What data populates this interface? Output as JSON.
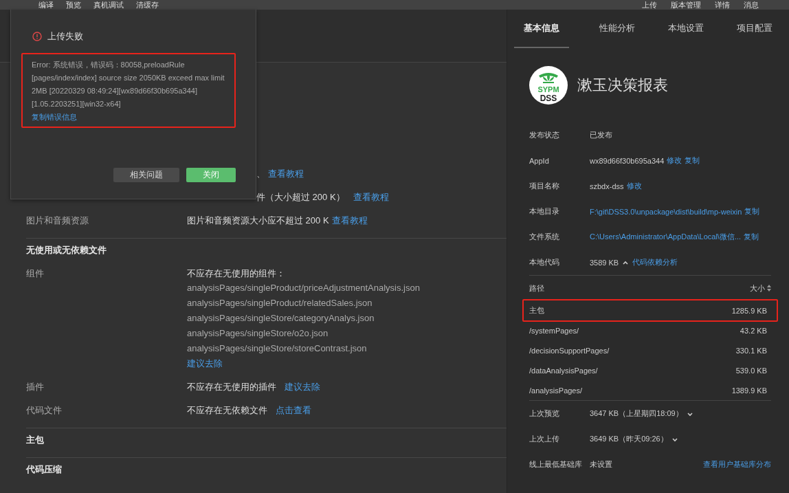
{
  "toolbar": {
    "left_items": [
      "编译",
      "预览",
      "真机调试",
      "清缓存"
    ],
    "right_items": [
      "上传",
      "版本管理",
      "详情",
      "消息"
    ]
  },
  "analysis": {
    "sections": [
      {
        "rows": [
          {
            "kind": "partial",
            "value": "、",
            "link": "查看教程"
          },
          {
            "kind": "partial",
            "value": "件（大小超过 200 K）",
            "link": "查看教程"
          },
          {
            "kind": "row",
            "label": "图片和音频资源",
            "value": "图片和音频资源大小应不超过 200 K",
            "link": "查看教程"
          }
        ]
      },
      {
        "title": "无使用或无依赖文件",
        "rows": [
          {
            "kind": "list",
            "label": "组件",
            "value": "不应存在无使用的组件：",
            "files": [
              "analysisPages/singleProduct/priceAdjustmentAnalysis.json",
              "analysisPages/singleProduct/relatedSales.json",
              "analysisPages/singleStore/categoryAnalys.json",
              "analysisPages/singleStore/o2o.json",
              "analysisPages/singleStore/storeContrast.json"
            ],
            "link": "建议去除"
          },
          {
            "kind": "row",
            "label": "插件",
            "value": "不应存在无使用的插件",
            "link": "建议去除"
          },
          {
            "kind": "row",
            "label": "代码文件",
            "value": "不应存在无依赖文件",
            "link": "点击查看"
          }
        ]
      },
      {
        "title": "主包"
      },
      {
        "title": "代码压缩"
      }
    ]
  },
  "details": {
    "tabs": [
      {
        "label": "基本信息",
        "selected": true
      },
      {
        "label": "性能分析",
        "selected": false
      },
      {
        "label": "本地设置",
        "selected": false
      },
      {
        "label": "项目配置",
        "selected": false
      }
    ],
    "app": {
      "logo_text": [
        "SYPM",
        "DSS"
      ],
      "name": "漱玉决策报表"
    },
    "info": [
      {
        "label": "发布状态",
        "kind": "text",
        "value": "已发布"
      },
      {
        "label": "AppId",
        "kind": "text",
        "value": "wx89d66f30b695a344",
        "links": [
          "修改",
          "复制"
        ]
      },
      {
        "label": "项目名称",
        "kind": "text",
        "value": "szbdx-dss",
        "links": [
          "修改"
        ]
      },
      {
        "label": "本地目录",
        "kind": "path",
        "value": "F:\\git\\DSS3.0\\unpackage\\dist\\build\\mp-weixin",
        "links": [
          "复制"
        ]
      },
      {
        "label": "文件系统",
        "kind": "path",
        "value": "C:\\Users\\Administrator\\AppData\\Local\\微信...",
        "links": [
          "复制"
        ]
      },
      {
        "label": "本地代码",
        "kind": "text",
        "value": "3589 KB",
        "expanded": true,
        "links": [
          "代码依赖分析"
        ]
      }
    ],
    "packages": {
      "columns": [
        "路径",
        "大小"
      ],
      "rows": [
        {
          "path": "主包",
          "size": "1285.9 KB",
          "highlighted": true
        },
        {
          "path": "/systemPages/",
          "size": "43.2 KB",
          "highlighted": false
        },
        {
          "path": "/decisionSupportPages/",
          "size": "330.1 KB",
          "highlighted": false
        },
        {
          "path": "/dataAnalysisPages/",
          "size": "539.0 KB",
          "highlighted": false
        },
        {
          "path": "/analysisPages/",
          "size": "1389.9 KB",
          "highlighted": false
        }
      ]
    },
    "history": [
      {
        "label": "上次预览",
        "value": "3647 KB（上星期四18:09）",
        "expanded": false
      },
      {
        "label": "上次上传",
        "value": "3649 KB（昨天09:26）",
        "expanded": false
      }
    ],
    "base_lib": {
      "label": "线上最低基础库",
      "value": "未设置",
      "link": "查看用户基础库分布"
    }
  },
  "dialog": {
    "title": "上传失败",
    "error": {
      "text": "Error: 系统错误，错误码：80058,preloadRule [pages/index/index] source size 2050KB exceed max limit 2MB [20220329 08:49:24][wx89d66f30b695a344] [1.05.2203251][win32-x64]",
      "link": "复制错误信息",
      "highlighted": true
    },
    "buttons": [
      {
        "label": "相关问题",
        "kind": "secondary"
      },
      {
        "label": "关闭",
        "kind": "primary"
      }
    ]
  }
}
